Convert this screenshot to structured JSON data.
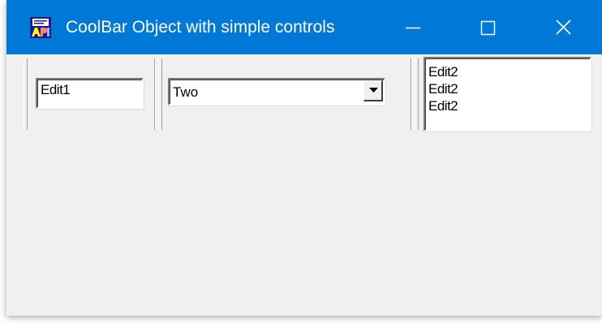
{
  "window": {
    "title": "CoolBar Object with simple controls",
    "icon": "app-icon"
  },
  "caption_buttons": {
    "minimize_icon": "minimize-icon",
    "maximize_icon": "maximize-icon",
    "close_icon": "close-icon"
  },
  "coolbar": {
    "edit1": {
      "value": "Edit1"
    },
    "combo": {
      "selected": "Two",
      "arrow_icon": "dropdown-arrow-icon"
    },
    "edit2": {
      "lines": [
        "Edit2",
        "Edit2",
        "Edit2"
      ]
    }
  },
  "colors": {
    "titlebar": "#0078d7",
    "client_background": "#f0f0f0"
  }
}
